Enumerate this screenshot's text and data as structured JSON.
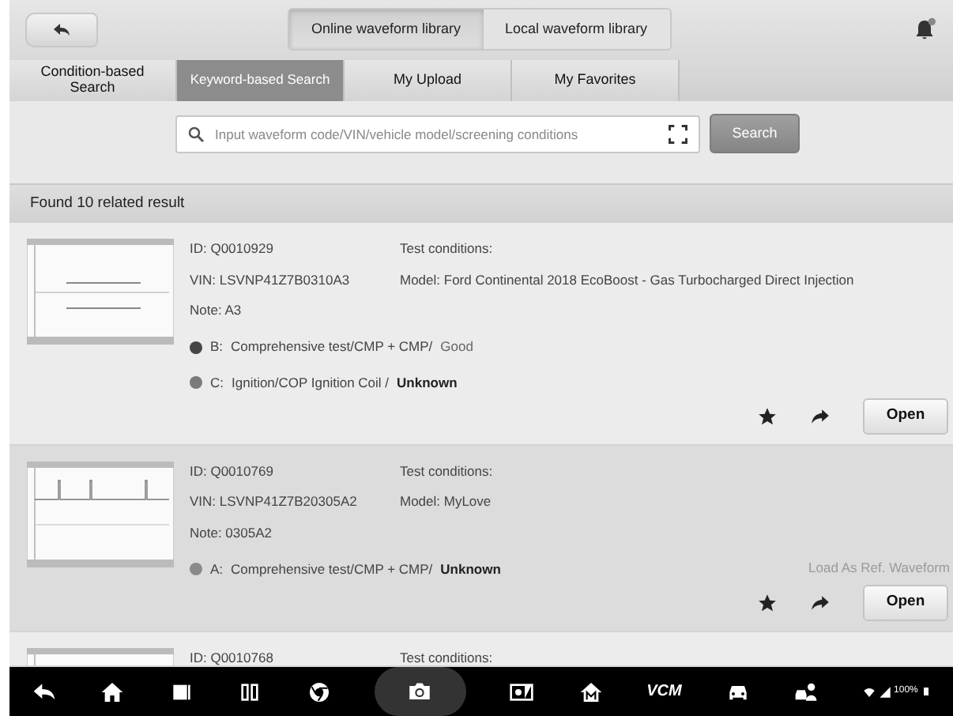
{
  "library_tabs": [
    {
      "label": "Online waveform library",
      "selected": true
    },
    {
      "label": "Local waveform library",
      "selected": false
    }
  ],
  "search_tabs": [
    {
      "label": "Condition-based Search",
      "selected": false
    },
    {
      "label": "Keyword-based Search",
      "selected": true
    },
    {
      "label": "My Upload",
      "selected": false
    },
    {
      "label": "My Favorites",
      "selected": false
    }
  ],
  "search": {
    "placeholder": "Input waveform code/VIN/vehicle model/screening conditions",
    "button": "Search"
  },
  "results_header": "Found 10 related result",
  "results": [
    {
      "selected": false,
      "id": "ID: Q0010929",
      "vin": "VIN: LSVNP41Z7B0310A3",
      "note": "Note: A3",
      "test_conditions": "Test conditions:",
      "model": "Model: Ford Continental 2018 EcoBoost - Gas Turbocharged Direct Injection",
      "tests": [
        {
          "channel": "B:",
          "name": "Comprehensive test/CMP + CMP/",
          "result": "Good",
          "result_bold": false,
          "color": "#454545"
        },
        {
          "channel": "C:",
          "name": "Ignition/COP Ignition Coil /",
          "result": "Unknown",
          "result_bold": true,
          "color": "#7a7a7a"
        }
      ],
      "open": "Open"
    },
    {
      "selected": true,
      "id": "ID: Q0010769",
      "vin": "VIN: LSVNP41Z7B20305A2",
      "note": "Note: 0305A2",
      "test_conditions": "Test conditions:",
      "model": "Model: MyLove",
      "tests": [
        {
          "channel": "A:",
          "name": "Comprehensive test/CMP + CMP/",
          "result": "Unknown",
          "result_bold": true,
          "color": "#8a8a8a"
        }
      ],
      "load_ref": "Load As Ref. Waveform",
      "open": "Open"
    },
    {
      "selected": false,
      "id": "ID: Q0010768",
      "test_conditions": "Test conditions:"
    }
  ],
  "nav_bar": {
    "vcm_label": "VCM",
    "battery": "100%"
  }
}
